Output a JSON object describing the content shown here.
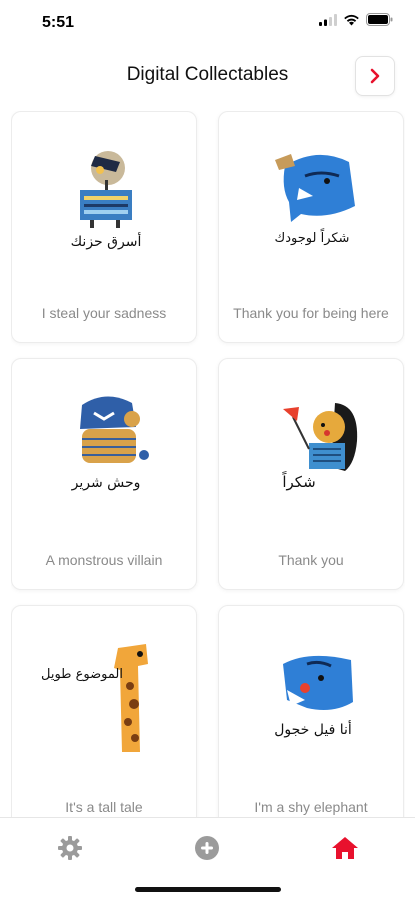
{
  "status_bar": {
    "time": "5:51"
  },
  "header": {
    "title": "Digital Collectables",
    "next_icon": "chevron-right-icon"
  },
  "colors": {
    "accent": "#e8112d",
    "card_border": "#ececec",
    "caption": "#8a8a8a",
    "tab_inactive": "#9b9b9b"
  },
  "cards": [
    {
      "caption": "I steal your sadness",
      "arabic": "أسرق حزنك",
      "art": "robot-character"
    },
    {
      "caption": "Thank you for being here",
      "arabic": "شكراً لوجودك",
      "art": "blue-elephant-character"
    },
    {
      "caption": "A monstrous villain",
      "arabic": "وحش شرير",
      "art": "monster-character"
    },
    {
      "caption": "Thank you",
      "arabic": "شكراً",
      "art": "girl-with-flower-character"
    },
    {
      "caption": "It's a tall tale",
      "arabic": "الموضوع طويل",
      "art": "giraffe-character"
    },
    {
      "caption": "I'm a shy elephant",
      "arabic": "أنا فيل خجول",
      "art": "shy-elephant-character"
    }
  ],
  "tab_bar": {
    "items": [
      {
        "icon": "gear-icon",
        "active": false
      },
      {
        "icon": "plus-circle-icon",
        "active": false
      },
      {
        "icon": "home-icon",
        "active": true
      }
    ]
  }
}
